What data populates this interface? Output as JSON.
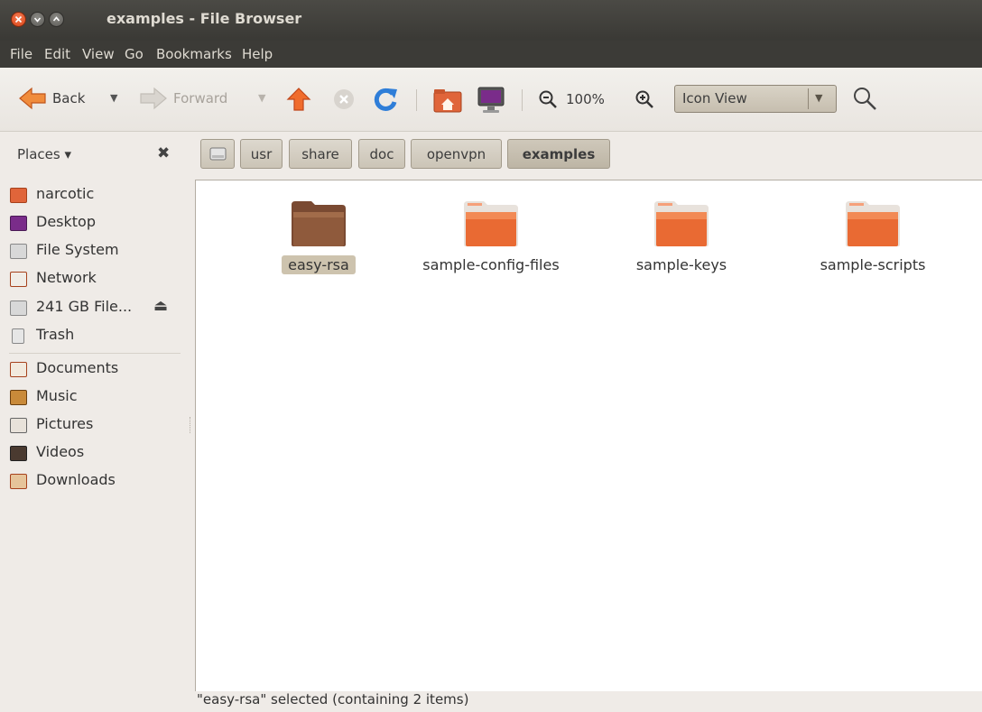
{
  "window": {
    "title": "examples - File Browser"
  },
  "menu": [
    "File",
    "Edit",
    "View",
    "Go",
    "Bookmarks",
    "Help"
  ],
  "toolbar": {
    "back_label": "Back",
    "forward_label": "Forward",
    "zoom_level": "100%",
    "view_mode": "Icon View"
  },
  "sidebar": {
    "header": "Places ▾",
    "items": [
      {
        "label": "narcotic",
        "icon": "home-folder-icon"
      },
      {
        "label": "Desktop",
        "icon": "desktop-icon"
      },
      {
        "label": "File System",
        "icon": "drive-icon"
      },
      {
        "label": "Network",
        "icon": "network-icon"
      },
      {
        "label": "241 GB File...",
        "icon": "drive-icon"
      },
      {
        "label": "Trash",
        "icon": "trash-icon"
      },
      {
        "label": "Documents",
        "icon": "documents-folder-icon"
      },
      {
        "label": "Music",
        "icon": "music-folder-icon"
      },
      {
        "label": "Pictures",
        "icon": "pictures-folder-icon"
      },
      {
        "label": "Videos",
        "icon": "videos-folder-icon"
      },
      {
        "label": "Downloads",
        "icon": "downloads-folder-icon"
      }
    ]
  },
  "breadcrumb": [
    "usr",
    "share",
    "doc",
    "openvpn",
    "examples"
  ],
  "files": [
    {
      "name": "easy-rsa",
      "selected": true
    },
    {
      "name": "sample-config-files",
      "selected": false
    },
    {
      "name": "sample-keys",
      "selected": false
    },
    {
      "name": "sample-scripts",
      "selected": false
    }
  ],
  "status": "\"easy-rsa\" selected (containing 2 items)",
  "colors": {
    "accent": "#dd4814",
    "selected_folder": "#8f5a3c",
    "titlebar": "#3c3b37"
  }
}
